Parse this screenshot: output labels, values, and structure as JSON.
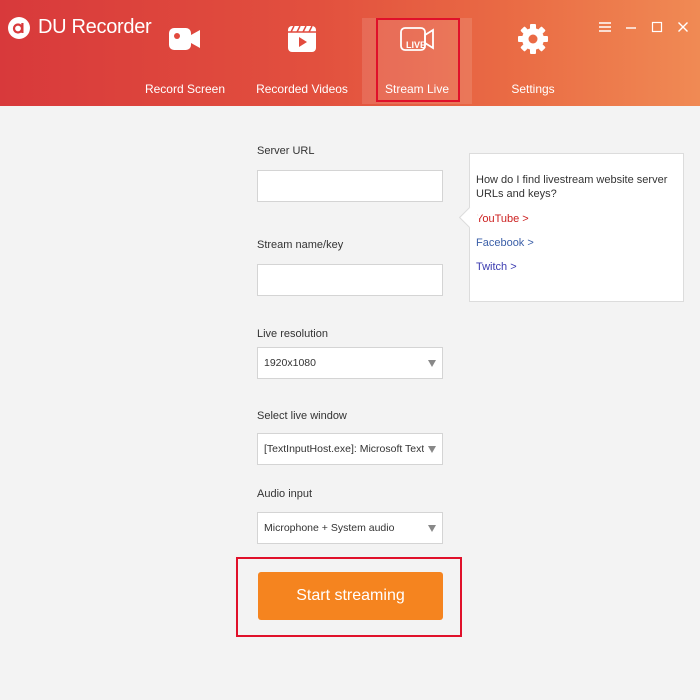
{
  "app": {
    "title": "DU Recorder"
  },
  "window_controls": {
    "menu_icon": "hamburger-icon",
    "minimize_icon": "minimize-icon",
    "maximize_icon": "maximize-icon",
    "close_icon": "close-icon"
  },
  "tabs": [
    {
      "label": "Record Screen",
      "icon": "video-camera-icon"
    },
    {
      "label": "Recorded Videos",
      "icon": "video-play-icon"
    },
    {
      "label": "Stream Live",
      "icon": "live-camera-icon",
      "icon_text": "LIVE",
      "active": true
    },
    {
      "label": "Settings",
      "icon": "gear-icon"
    }
  ],
  "form": {
    "server_url": {
      "label": "Server URL",
      "value": "",
      "placeholder": ""
    },
    "stream_key": {
      "label": "Stream name/key",
      "value": "",
      "placeholder": ""
    },
    "live_resolution": {
      "label": "Live resolution",
      "value": "1920x1080"
    },
    "live_window": {
      "label": "Select live window",
      "value": "[TextInputHost.exe]: Microsoft Text Input A"
    },
    "audio_input": {
      "label": "Audio input",
      "value": "Microphone + System audio"
    }
  },
  "start_button": {
    "label": "Start streaming"
  },
  "help_tooltip": {
    "question": "How do I find livestream website server URLs and keys?",
    "links": [
      {
        "label": "YouTube >",
        "color": "#cc1f1f"
      },
      {
        "label": "Facebook >",
        "color": "#3b5fa8"
      },
      {
        "label": "Twitch >",
        "color": "#3b3bb0"
      }
    ]
  },
  "colors": {
    "header_start": "#d8393b",
    "header_end": "#f08a54",
    "accent_orange": "#f5841f",
    "highlight_red": "#e0102a"
  }
}
